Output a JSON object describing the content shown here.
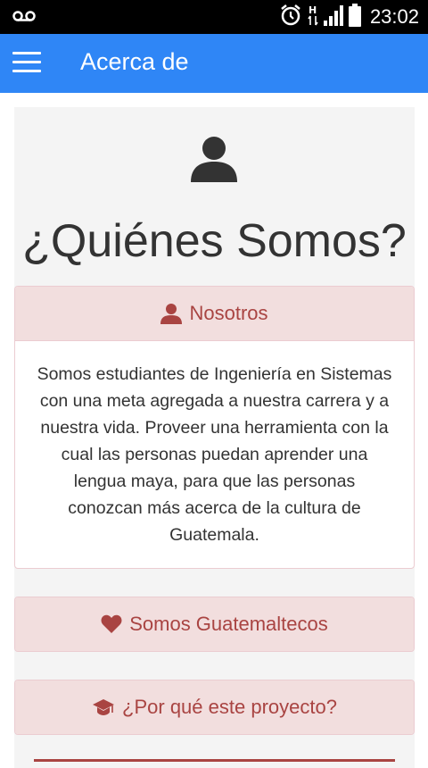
{
  "status_bar": {
    "time": "23:02"
  },
  "app_bar": {
    "title": "Acerca de"
  },
  "main": {
    "heading": "¿Quiénes Somos?",
    "panels": [
      {
        "title": "Nosotros",
        "icon": "user-icon",
        "body": "Somos estudiantes de Ingeniería en Sistemas con una meta agregada a nuestra carrera y a nuestra vida. Proveer una herramienta con la cual las personas puedan aprender una lengua maya, para que las personas conozcan más acerca de la cultura de Guatemala."
      },
      {
        "title": "Somos Guatemaltecos",
        "icon": "heart-icon"
      },
      {
        "title": "¿Por qué este proyecto?",
        "icon": "graduation-cap-icon"
      }
    ]
  },
  "colors": {
    "app_bar": "#2f86f6",
    "panel_heading_bg": "#f2dede",
    "panel_heading_text": "#a94442",
    "panel_border": "#ebccd1",
    "jumbotron_bg": "#f4f4f4"
  }
}
